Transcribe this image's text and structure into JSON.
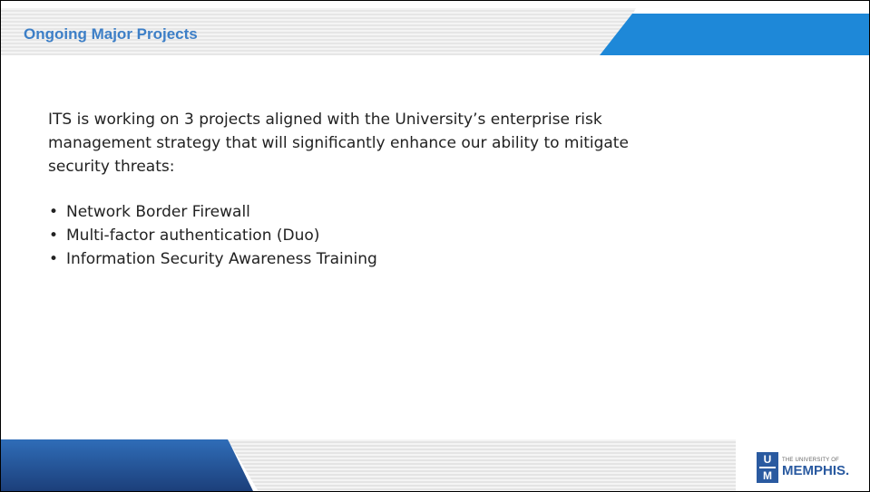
{
  "header": {
    "title": "Ongoing Major Projects"
  },
  "body": {
    "intro": "ITS is working on 3 projects aligned with the University’s enterprise risk management strategy that will significantly enhance our ability to mitigate security threats:",
    "bullets": [
      "Network Border Firewall",
      "Multi-factor authentication (Duo)",
      "Information Security Awareness Training"
    ]
  },
  "logo": {
    "mark_top": "U",
    "mark_bottom": "M",
    "small_text": "THE UNIVERSITY OF",
    "name": "MEMPHIS."
  },
  "colors": {
    "title": "#3d7fc7",
    "accent_blue": "#1e88d8",
    "footer_blue": "#2f6db8",
    "logo_blue": "#2a5aa0"
  }
}
